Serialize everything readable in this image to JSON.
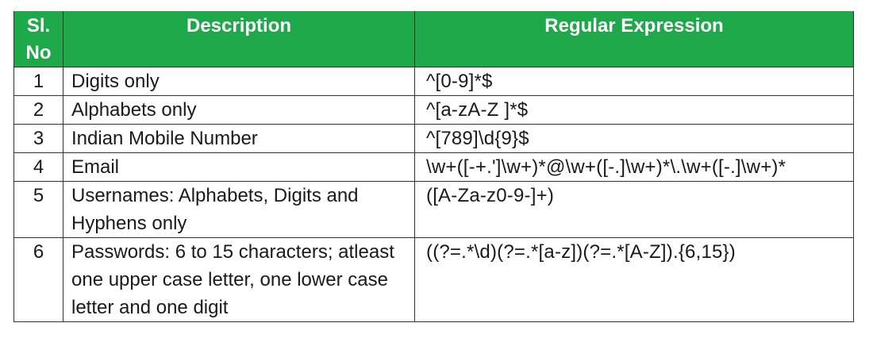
{
  "header": {
    "slno": "Sl. No",
    "description": "Description",
    "regex": "Regular Expression"
  },
  "rows": [
    {
      "num": "1",
      "description": "Digits only",
      "regex": "^[0-9]*$"
    },
    {
      "num": "2",
      "description": "Alphabets only",
      "regex": "^[a-zA-Z ]*$"
    },
    {
      "num": "3",
      "description": "Indian Mobile Number",
      "regex": "^[789]\\d{9}$"
    },
    {
      "num": "4",
      "description": "Email",
      "regex": "\\w+([-+.']\\w+)*@\\w+([-.]\\w+)*\\.\\w+([-.]\\w+)*"
    },
    {
      "num": "5",
      "description": "Usernames: Alphabets, Digits and Hyphens only",
      "regex": "([A-Za-z0-9-]+)"
    },
    {
      "num": "6",
      "description": "Passwords: 6 to 15 characters; atleast one upper case letter, one lower case letter and one digit",
      "regex": "((?=.*\\d)(?=.*[a-z])(?=.*[A-Z]).{6,15})"
    }
  ],
  "colors": {
    "header_bg": "#1fa84a",
    "header_text": "#ffffff",
    "border": "#333333"
  }
}
